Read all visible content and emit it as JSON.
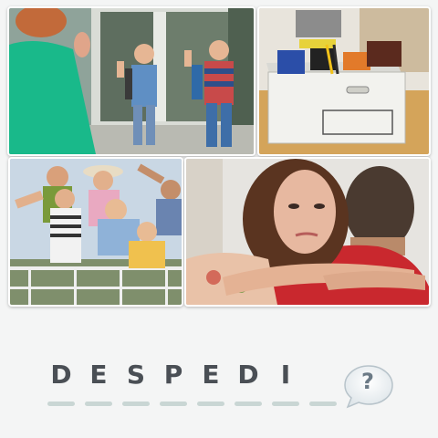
{
  "puzzle": {
    "images": [
      {
        "icon": "kids-waving-goodbye-photo"
      },
      {
        "icon": "box-of-office-items-photo"
      },
      {
        "icon": "people-waving-from-ship-photo"
      },
      {
        "icon": "crying-woman-hugging-man-photo"
      }
    ],
    "letters": [
      "D",
      "E",
      "S",
      "P",
      "E",
      "D",
      "I",
      "",
      ""
    ]
  },
  "hint_button": {
    "label": "?",
    "icon": "hint-speech-bubble-icon"
  },
  "colors": {
    "background": "#f4f5f5",
    "letter": "#4a4f55",
    "slot_bar": "#c9d6d4",
    "hint_icon": "#6b7a86"
  }
}
